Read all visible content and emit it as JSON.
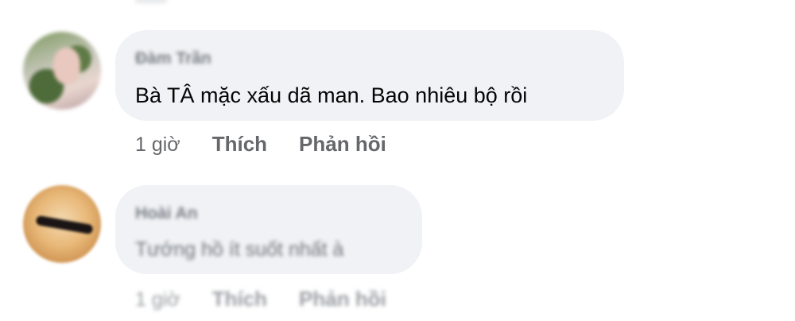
{
  "comments": [
    {
      "author": "Đàm Trần",
      "text": "Bà TÂ mặc xấu dã man. Bao nhiêu bộ rồi",
      "time": "1 giờ",
      "like_label": "Thích",
      "reply_label": "Phản hồi"
    },
    {
      "author": "Hoài An",
      "text": "Tướng hồ ít suốt nhất à",
      "time": "1 giờ",
      "like_label": "Thích",
      "reply_label": "Phản hồi"
    }
  ],
  "colors": {
    "bubble_bg": "#f0f2f5",
    "secondary_text": "#65676b",
    "primary_text": "#050505"
  }
}
